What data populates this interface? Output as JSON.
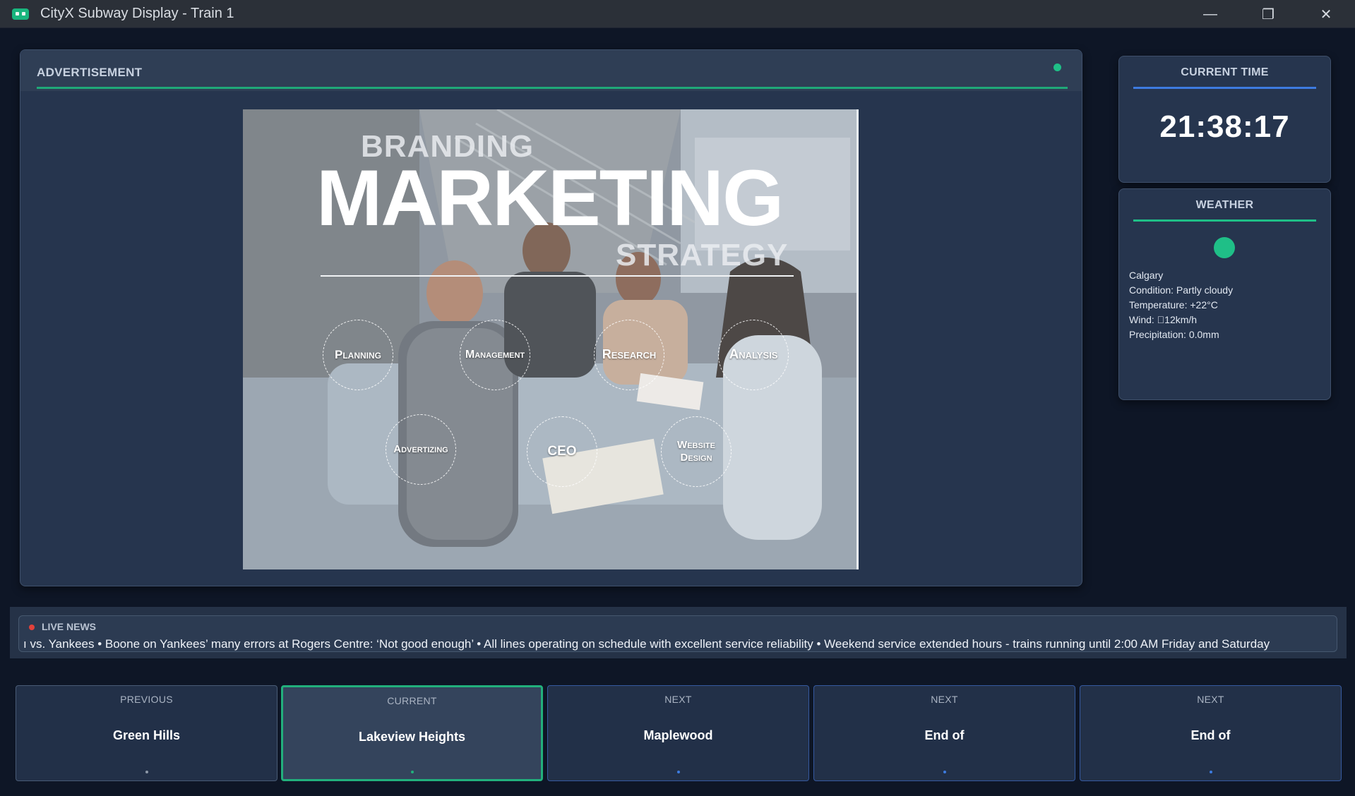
{
  "window": {
    "title": "CityX Subway Display - Train 1",
    "controls": {
      "minimize": "—",
      "maximize": "❐",
      "close": "✕"
    }
  },
  "advertisement": {
    "panel_title": "ADVERTISEMENT",
    "status_color": "#1fbf87",
    "image": {
      "kicker": "BRANDING",
      "headline": "MARKETING",
      "subhead": "STRATEGY",
      "bubbles": [
        "Planning",
        "Management",
        "Research",
        "Analysis",
        "Advertizing",
        "CEO",
        "Website Design"
      ]
    }
  },
  "current_time": {
    "title": "CURRENT TIME",
    "value": "21:38:17",
    "accent": "#3d7be0"
  },
  "weather": {
    "title": "WEATHER",
    "accent": "#1fbf87",
    "icon": "weather-status-dot",
    "city": "Calgary",
    "condition": "Condition: Partly cloudy",
    "temperature": "Temperature: +22°C",
    "wind": "Wind: ⃕12km/h",
    "precipitation": "Precipitation: 0.0mm"
  },
  "news": {
    "label": "LIVE NEWS",
    "ticker": "ı vs. Yankees • Boone on Yankees’ many errors at Rogers Centre: ‘Not good enough’ • All lines operating on schedule with excellent service reliability • Weekend service extended hours - trains running until 2:00 AM Friday and Saturday"
  },
  "stations": [
    {
      "label": "PREVIOUS",
      "name": "Green Hills"
    },
    {
      "label": "CURRENT",
      "name": "Lakeview Heights"
    },
    {
      "label": "NEXT",
      "name": "Maplewood"
    },
    {
      "label": "NEXT",
      "name": "End of"
    },
    {
      "label": "NEXT",
      "name": "End of"
    }
  ]
}
